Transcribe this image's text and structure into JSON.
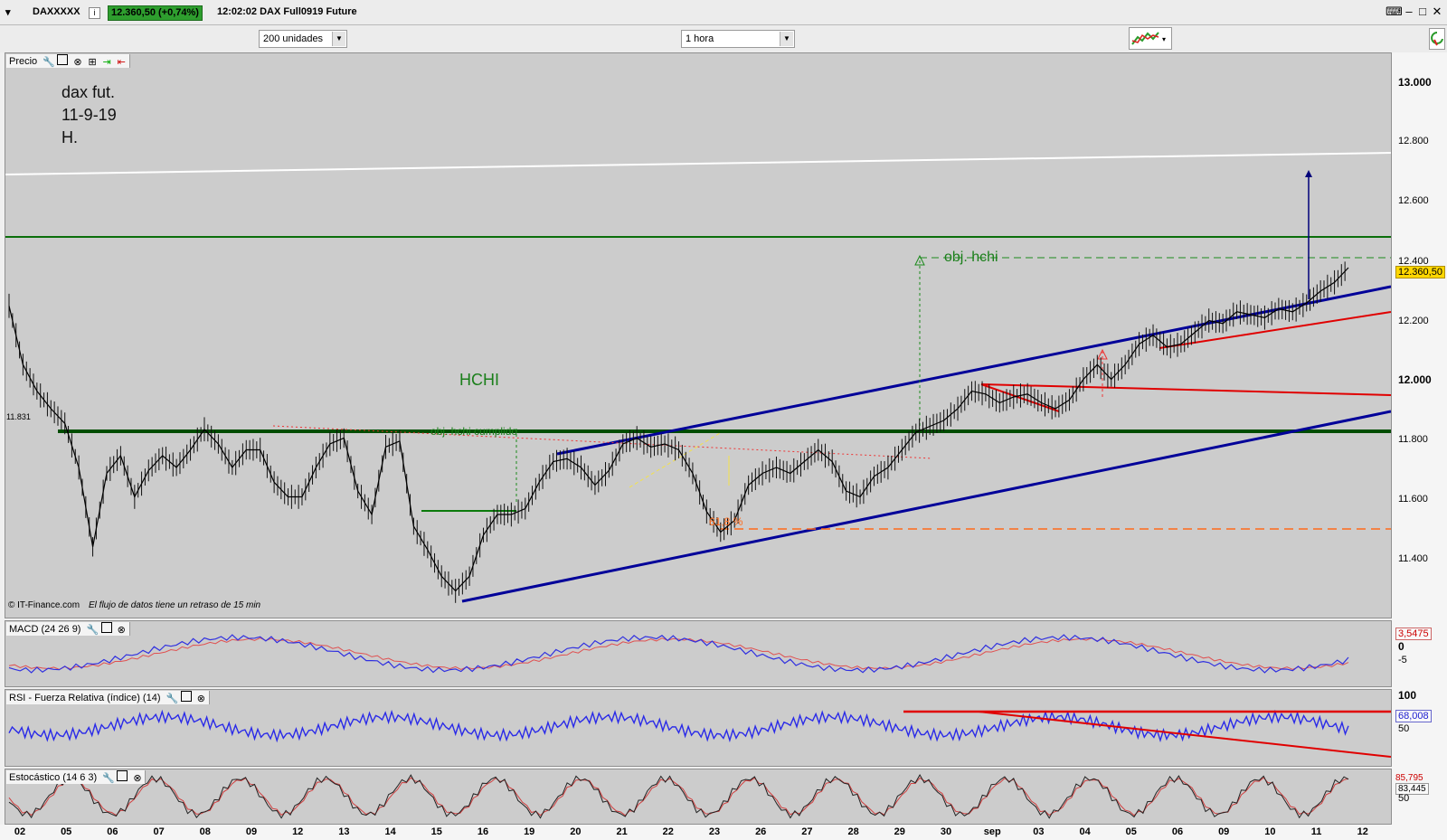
{
  "window": {
    "symbol": "DAXXXXX",
    "price_change": "12.360,50 (+0,74%)",
    "time_and_name": "12:02:02 DAX Full0919 Future",
    "info_icon": "info-icon",
    "keyboard_icon": "keyboard-icon"
  },
  "toolbar": {
    "units_select": "200 unidades",
    "interval_select": "1 hora",
    "chart_type_icon": "chart-type-icon",
    "refresh_icon": "refresh-icon"
  },
  "price_panel": {
    "label": "Precio",
    "annotation_lines": [
      "dax fut.",
      "11-9-19",
      "H."
    ],
    "hchi_label": "HCHI",
    "obj_label": "obj. hchi",
    "obj_done_label": "obj. hchi cumplido",
    "fib_label": "61,8 %",
    "left_value": "11.831",
    "copyright": "© IT-Finance.com",
    "delay_note": "El flujo de datos tiene un retraso de 15 min",
    "last_price_tag": "12.360,50",
    "y_ticks": [
      "13.000",
      "12.800",
      "12.600",
      "12.400",
      "12.200",
      "12.000",
      "11.800",
      "11.600",
      "11.400"
    ]
  },
  "macd_panel": {
    "label": "MACD (24 26 9)",
    "value_tag": "3,5475",
    "y_ticks": [
      "0",
      "-5"
    ]
  },
  "rsi_panel": {
    "label": "RSI - Fuerza Relativa (índice) (14)",
    "value_tag": "68,008",
    "y_ticks": [
      "100",
      "50"
    ]
  },
  "stoch_panel": {
    "label": "Estocástico (14 6 3)",
    "value_tag_1": "85,795",
    "value_tag_2": "83,445",
    "y_ticks": [
      "50"
    ]
  },
  "colors": {
    "panel_bg": "#cccccc",
    "channel": "#000099",
    "support": "#006400",
    "resistance": "#e00000",
    "fib": "#ff6a1a",
    "target": "#00007a"
  },
  "chart_data": {
    "type": "line",
    "title": "",
    "y_range": [
      11200,
      13100
    ],
    "x_labels": [
      "02",
      "05",
      "06",
      "07",
      "08",
      "09",
      "12",
      "13",
      "14",
      "15",
      "16",
      "19",
      "20",
      "21",
      "22",
      "23",
      "26",
      "27",
      "28",
      "29",
      "30",
      "sep",
      "03",
      "04",
      "05",
      "06",
      "09",
      "10",
      "11",
      "12"
    ],
    "series": [
      {
        "values": [
          12250,
          12050,
          11960,
          11900,
          11850,
          11700,
          11430,
          11680,
          11740,
          11600,
          11690,
          11740,
          11700,
          11760,
          11830,
          11780,
          11700,
          11760,
          11760,
          11650,
          11600,
          11600,
          11700,
          11780,
          11800,
          11620,
          11540,
          11770,
          11790,
          11500,
          11420,
          11330,
          11280,
          11330,
          11470,
          11540,
          11540,
          11560,
          11650,
          11720,
          11730,
          11700,
          11640,
          11690,
          11780,
          11800,
          11770,
          11780,
          11760,
          11680,
          11550,
          11480,
          11520,
          11640,
          11680,
          11700,
          11680,
          11720,
          11760,
          11720,
          11620,
          11600,
          11670,
          11700,
          11760,
          11820,
          11840,
          11860,
          11900,
          11960,
          11950,
          11920,
          11940,
          11950,
          11920,
          11900,
          11930,
          12000,
          12050,
          12000,
          12050,
          12120,
          12150,
          12110,
          12120,
          12160,
          12200,
          12190,
          12230,
          12220,
          12210,
          12240,
          12230,
          12260,
          12300,
          12330,
          12380
        ]
      }
    ],
    "levels": {
      "neckline": 11831,
      "hchi_objective": 12410,
      "green_resistance": 12490,
      "fib_618": 11480,
      "last_close": 12360.5
    },
    "macd_last": 3.5475,
    "rsi_last": 68.008,
    "stoch_last": [
      85.795,
      83.445
    ]
  }
}
